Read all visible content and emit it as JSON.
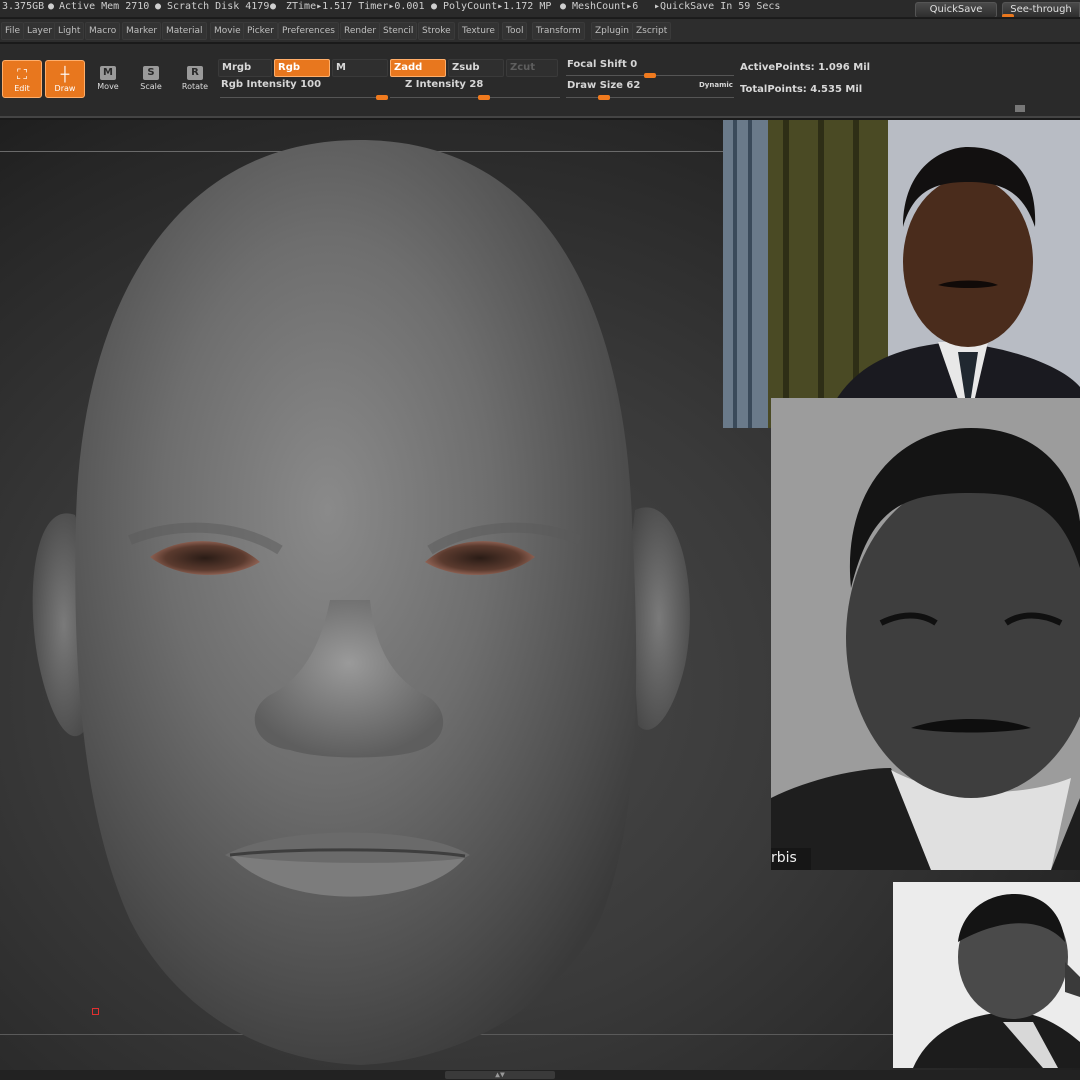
{
  "status": {
    "items": [
      {
        "key": "mem",
        "text": "3.375GB"
      },
      {
        "key": "active_mem",
        "text": "Active Mem 2710"
      },
      {
        "key": "scratch",
        "text": "Scratch Disk 4179"
      },
      {
        "key": "ztime",
        "text": "ZTime▸1.517 Timer▸0.001"
      },
      {
        "key": "polycount",
        "text": "PolyCount▸1.172 MP"
      },
      {
        "key": "meshcount",
        "text": "MeshCount▸6"
      },
      {
        "key": "quicksave_timer",
        "text": "▸QuickSave In 59 Secs"
      }
    ],
    "quicksave_label": "QuickSave",
    "see_through_label": "See-through"
  },
  "menu": [
    "File",
    "Layer",
    "Light",
    "Macro",
    "Marker",
    "Material",
    "Movie",
    "Picker",
    "Preferences",
    "Render",
    "Stencil",
    "Stroke",
    "Texture",
    "Tool",
    "Transform",
    "Zplugin",
    "Zscript"
  ],
  "tools": {
    "edit": "Edit",
    "draw": "Draw",
    "move": "Move",
    "scale": "Scale",
    "rotate": "Rotate",
    "move_glyph": "M",
    "scale_glyph": "S",
    "rotate_glyph": "R"
  },
  "modes": {
    "mrgb": "Mrgb",
    "rgb": "Rgb",
    "m": "M",
    "zadd": "Zadd",
    "zsub": "Zsub",
    "zcut": "Zcut"
  },
  "sliders": {
    "rgb_intensity": {
      "label": "Rgb Intensity",
      "value": "100",
      "level": 100
    },
    "z_intensity": {
      "label": "Z Intensity",
      "value": "28",
      "level": 28
    },
    "focal_shift": {
      "label": "Focal Shift",
      "value": "0",
      "level": 0
    },
    "draw_size": {
      "label": "Draw Size",
      "value": "62",
      "level": 62
    },
    "dynamic_label": "Dynamic"
  },
  "points": {
    "active": "ActivePoints: 1.096 Mil",
    "total": "TotalPoints: 4.535 Mil"
  },
  "references": {
    "caption": "rbis"
  },
  "colors": {
    "accent": "#e8771e",
    "panel": "#2a2a2a"
  }
}
